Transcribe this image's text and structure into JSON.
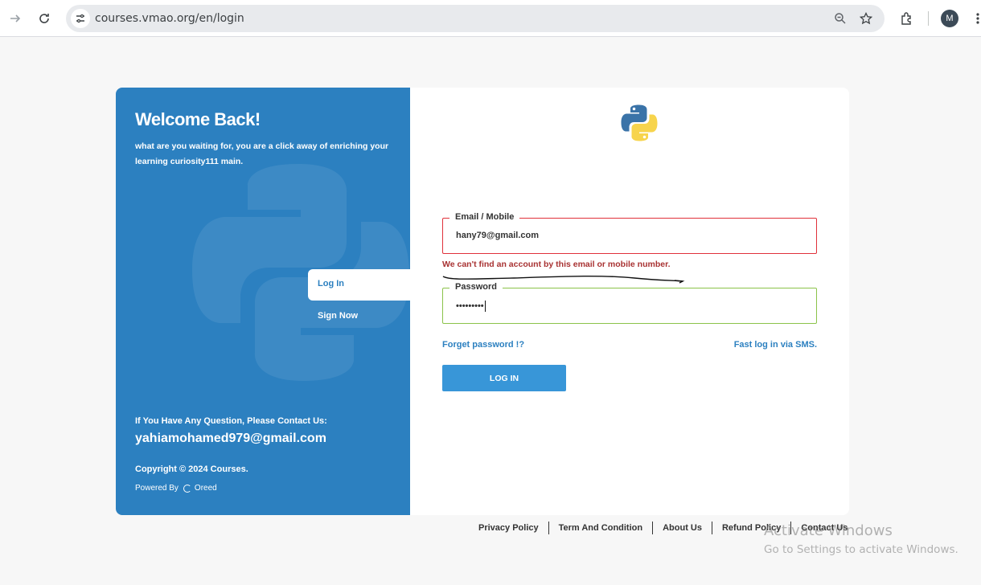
{
  "browser": {
    "url": "courses.vmao.org/en/login",
    "profile_initial": "M"
  },
  "left_panel": {
    "title": "Welcome Back!",
    "subtitle": "what are you waiting for, you are a click away of enriching your learning curiosity111 main.",
    "tabs": [
      {
        "label": "Log In",
        "active": true
      },
      {
        "label": "Sign Now",
        "active": false
      }
    ],
    "contact_question": "If You Have Any Question, Please Contact Us:",
    "contact_email": "yahiamohamed979@gmail.com",
    "copyright": "Copyright © 2024 Courses.",
    "powered_by_label": "Powered By",
    "powered_by_name": "Oreed"
  },
  "form": {
    "logo_icon": "python-logo-icon",
    "email_label": "Email / Mobile",
    "email_value": "hany79@gmail.com",
    "email_error": "We can't find an account by this email or mobile number.",
    "password_label": "Password",
    "password_value": "•••••••••",
    "forgot_link": "Forget password !?",
    "sms_link": "Fast log in via SMS.",
    "login_button": "LOG IN"
  },
  "footer": {
    "links": [
      "Privacy Policy",
      "Term And Condition",
      "About Us",
      "Refund Policy",
      "Contact Us"
    ]
  },
  "overlay": {
    "line1": "Activate Windows",
    "line2": "Go to Settings to activate Windows."
  },
  "colors": {
    "brand_blue": "#2c80c0",
    "button_blue": "#3896d8",
    "error_red": "#e0313a",
    "valid_green": "#8bc34a"
  }
}
